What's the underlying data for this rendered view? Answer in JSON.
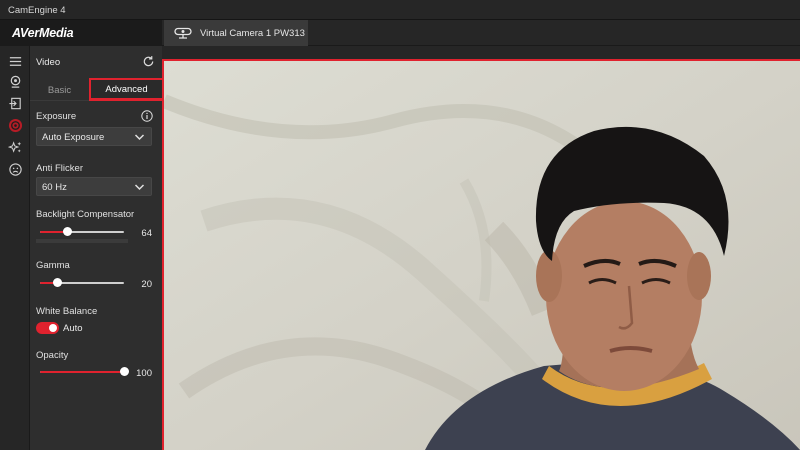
{
  "window": {
    "title": "CamEngine 4"
  },
  "brand": {
    "name": "AVerMedia"
  },
  "sidebar_icons": [
    {
      "icon": "menu-icon"
    },
    {
      "icon": "webcam-icon"
    },
    {
      "icon": "input-icon"
    },
    {
      "icon": "settings-gear-icon",
      "active": true
    },
    {
      "icon": "effects-sparkle-icon"
    },
    {
      "icon": "face-icon"
    }
  ],
  "panel": {
    "section_title": "Video",
    "tabs": {
      "basic": "Basic",
      "advanced": "Advanced",
      "selected": "Advanced"
    },
    "exposure": {
      "label": "Exposure",
      "value": "Auto Exposure"
    },
    "anti_flicker": {
      "label": "Anti Flicker",
      "value": "60 Hz"
    },
    "backlight": {
      "label": "Backlight Compensator",
      "value": "64",
      "fraction": 0.32
    },
    "gamma": {
      "label": "Gamma",
      "value": "20",
      "fraction": 0.2
    },
    "white_balance": {
      "label": "White Balance",
      "toggle_label": "Auto",
      "enabled": true
    },
    "opacity": {
      "label": "Opacity",
      "value": "100",
      "fraction": 1.0
    }
  },
  "camera_tab": {
    "name": "Virtual Camera 1 PW313"
  },
  "colors": {
    "accent": "#e0222e",
    "panel": "#2e2e2e",
    "titlebar": "#262626"
  }
}
